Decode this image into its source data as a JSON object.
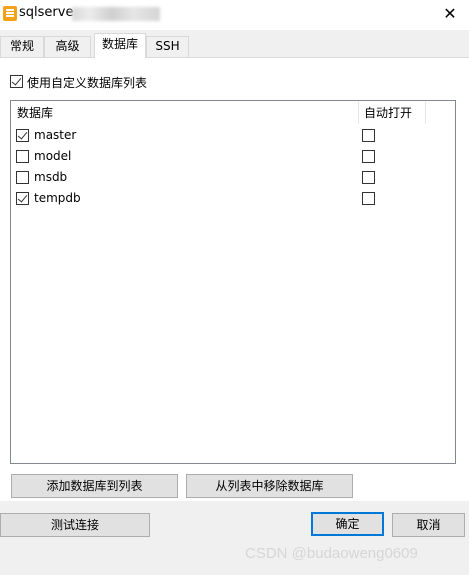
{
  "window": {
    "title": "sqlserve",
    "close_symbol": "✕"
  },
  "tabs": [
    {
      "label": "常规"
    },
    {
      "label": "高级"
    },
    {
      "label": "数据库"
    },
    {
      "label": "SSH"
    }
  ],
  "custom_list": {
    "label": "使用自定义数据库列表",
    "checked": true
  },
  "database_list": {
    "columns": [
      "数据库",
      "自动打开"
    ],
    "rows": [
      {
        "name": "master",
        "checked": true,
        "auto_open": false
      },
      {
        "name": "model",
        "checked": false,
        "auto_open": false
      },
      {
        "name": "msdb",
        "checked": false,
        "auto_open": false
      },
      {
        "name": "tempdb",
        "checked": true,
        "auto_open": false
      }
    ]
  },
  "buttons": {
    "add_to_list": "添加数据库到列表",
    "remove_from_list": "从列表中移除数据库",
    "test_connection": "测试连接",
    "ok": "确定",
    "cancel": "取消"
  },
  "watermark": "CSDN @budaoweng0609"
}
